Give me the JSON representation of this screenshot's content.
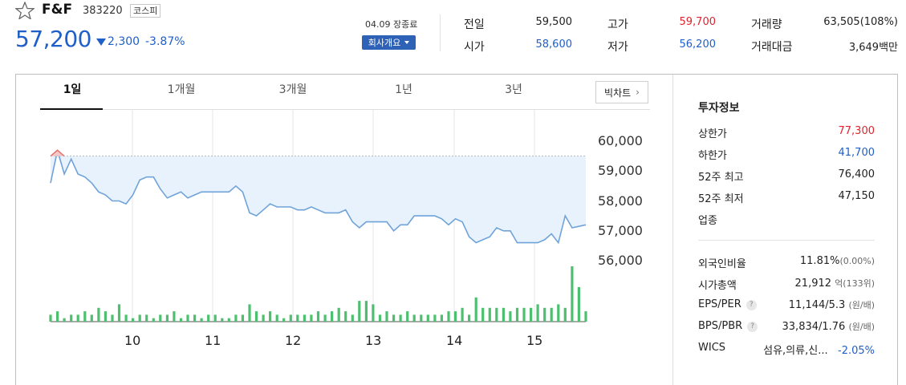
{
  "stock": {
    "name": "F&F",
    "code": "383220",
    "market": "코스피",
    "price": "57,200",
    "change": "2,300",
    "change_pct": "-3.87%",
    "date": "04.09 장종료",
    "company_btn": "회사개요"
  },
  "quote": {
    "prev_close_label": "전일",
    "prev_close": "59,500",
    "high_label": "고가",
    "high": "59,700",
    "volume_label": "거래량",
    "volume": "63,505(108%)",
    "open_label": "시가",
    "open": "58,600",
    "low_label": "저가",
    "low": "56,200",
    "amount_label": "거래대금",
    "amount": "3,649백만"
  },
  "tabs": [
    "1일",
    "1개월",
    "3개월",
    "1년",
    "3년"
  ],
  "active_tab": "1일",
  "big_chart_label": "빅차트",
  "chart_data": {
    "type": "line",
    "y_ticks": [
      "60,000",
      "59,000",
      "58,000",
      "57,000",
      "56,000"
    ],
    "x_ticks": [
      "10",
      "11",
      "12",
      "13",
      "14",
      "15"
    ],
    "ylim": [
      55500,
      60500
    ],
    "prev_close": 59500,
    "price": [
      58600,
      59700,
      58900,
      59400,
      58900,
      58800,
      58600,
      58300,
      58200,
      58000,
      58000,
      57900,
      58200,
      58700,
      58800,
      58800,
      58400,
      58100,
      58200,
      58300,
      58100,
      58200,
      58300,
      58300,
      58300,
      58300,
      58300,
      58500,
      58300,
      57600,
      57500,
      57700,
      57900,
      57800,
      57800,
      57800,
      57700,
      57700,
      57800,
      57700,
      57600,
      57600,
      57600,
      57700,
      57300,
      57100,
      57300,
      57300,
      57300,
      57300,
      57000,
      57200,
      57200,
      57500,
      57500,
      57500,
      57500,
      57400,
      57200,
      57400,
      57300,
      56800,
      56600,
      56700,
      56800,
      57100,
      57000,
      57000,
      56600,
      56600,
      56600,
      56600,
      56700,
      56900,
      56600,
      57500,
      57100,
      57150,
      57200
    ],
    "volume": [
      2,
      3,
      1,
      2,
      2,
      3,
      2,
      4,
      3,
      2,
      5,
      2,
      1,
      2,
      2,
      1,
      2,
      2,
      3,
      1,
      2,
      2,
      1,
      2,
      2,
      1,
      1,
      2,
      2,
      5,
      3,
      2,
      3,
      2,
      1,
      2,
      2,
      2,
      2,
      3,
      2,
      3,
      4,
      3,
      2,
      6,
      6,
      5,
      2,
      3,
      2,
      2,
      3,
      2,
      2,
      2,
      2,
      2,
      3,
      3,
      4,
      2,
      7,
      4,
      4,
      4,
      4,
      3,
      4,
      4,
      4,
      5,
      4,
      4,
      5,
      4,
      16,
      10,
      3
    ]
  },
  "invest": {
    "title": "투자정보",
    "rows1": [
      {
        "label": "상한가",
        "value": "77,300",
        "color": "red"
      },
      {
        "label": "하한가",
        "value": "41,700",
        "color": "blue"
      },
      {
        "label": "52주 최고",
        "value": "76,400",
        "color": "dark"
      },
      {
        "label": "52주 최저",
        "value": "47,150",
        "color": "dark"
      },
      {
        "label": "업종",
        "value": "",
        "color": "dark"
      }
    ],
    "foreign_label": "외국인비율",
    "foreign_value": "11.81%",
    "foreign_sub": "(0.00%)",
    "mcap_label": "시가총액",
    "mcap_value": "21,912",
    "mcap_sub": "억(133위)",
    "eps_label": "EPS/PER",
    "eps_value": "11,144/5.3",
    "eps_sub": "(원/배)",
    "bps_label": "BPS/PBR",
    "bps_value": "33,834/1.76",
    "bps_sub": "(원/배)",
    "wics_label": "WICS",
    "wics_value": "섬유,의류,신...",
    "wics_pct": "-2.05%"
  }
}
